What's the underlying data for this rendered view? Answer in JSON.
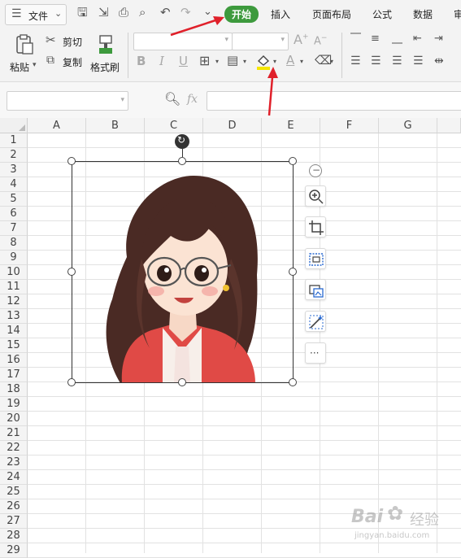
{
  "menu": {
    "hamburger_label": "文件",
    "tabs": [
      "开始",
      "插入",
      "页面布局",
      "公式",
      "数据",
      "审"
    ]
  },
  "ribbon": {
    "paste_label": "粘贴",
    "cut_label": "剪切",
    "copy_label": "复制",
    "format_painter_label": "格式刷",
    "bold": "B",
    "italic": "I",
    "underline": "U",
    "font_grow": "A",
    "font_shrink": "A",
    "font_color_letter": "A"
  },
  "formula_bar": {
    "fx_label": "fx",
    "name_box_value": "",
    "formula_value": ""
  },
  "columns": [
    "A",
    "B",
    "C",
    "D",
    "E",
    "F",
    "G"
  ],
  "rows": [
    "1",
    "2",
    "3",
    "4",
    "5",
    "6",
    "7",
    "8",
    "9",
    "10",
    "11",
    "12",
    "13",
    "14",
    "15",
    "16",
    "17",
    "18",
    "19",
    "20",
    "21",
    "22",
    "23",
    "24",
    "25",
    "26",
    "27",
    "28",
    "29"
  ],
  "side_toolbar": [
    "zoom-in",
    "crop",
    "frame",
    "replace-image",
    "edit-image",
    "more"
  ],
  "side_more_label": "···",
  "collapse_label": "−",
  "watermark": {
    "line1": "Bai",
    "line2": "经验",
    "line3": "jingyan.baidu.com"
  },
  "colors": {
    "active_tab": "#3d9a3d",
    "arrow": "#e0202a",
    "highlight": "#f5e600"
  }
}
